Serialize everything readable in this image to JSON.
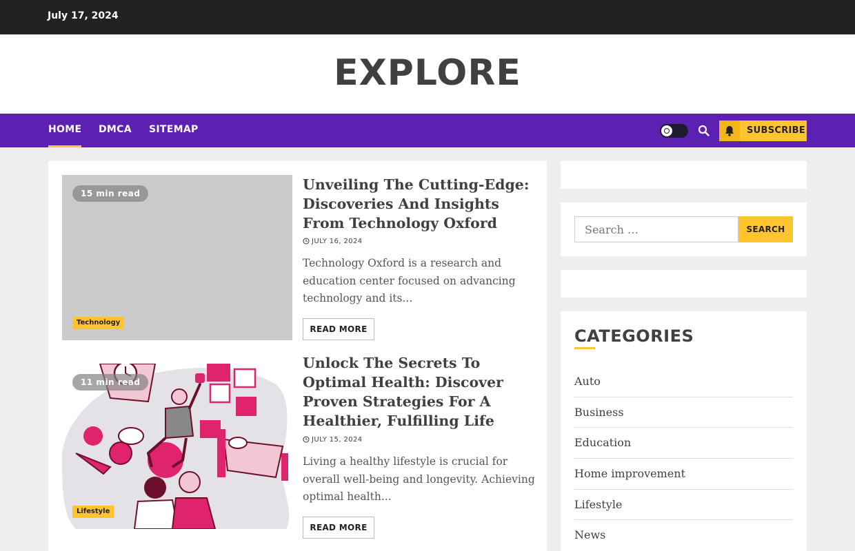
{
  "topbar": {
    "date": "July 17, 2024"
  },
  "site": {
    "title": "EXPLORE"
  },
  "nav": {
    "items": [
      {
        "label": "HOME",
        "active": true
      },
      {
        "label": "DMCA",
        "active": false
      },
      {
        "label": "SITEMAP",
        "active": false
      }
    ],
    "subscribe_label": "SUBSCRIBE",
    "icons": {
      "theme_toggle": "light-dark-toggle-icon",
      "search": "search-icon",
      "bell": "bell-icon"
    }
  },
  "posts": [
    {
      "read_time": "15 min read",
      "category": "Technology",
      "title": "Unveiling The Cutting-Edge: Discoveries And Insights From Technology Oxford",
      "date": "JULY 16, 2024",
      "excerpt": "Technology Oxford is a research and education center focused on advancing technology and its...",
      "read_more": "READ MORE"
    },
    {
      "read_time": "11 min read",
      "category": "Lifestyle",
      "title": "Unlock The Secrets To Optimal Health: Discover Proven Strategies For A Healthier, Fulfilling Life",
      "date": "JULY 15, 2024",
      "excerpt": "Living a healthy lifestyle is crucial for overall well-being and longevity. Achieving optimal health...",
      "read_more": "READ MORE"
    }
  ],
  "sidebar": {
    "search": {
      "placeholder": "Search …",
      "button": "SEARCH"
    },
    "categories": {
      "heading": "CATEGORIES",
      "items": [
        "Auto",
        "Business",
        "Education",
        "Home improvement",
        "Lifestyle",
        "News"
      ]
    }
  },
  "colors": {
    "nav_bg": "#5c21b2",
    "accent": "#ffc42e",
    "topbar_bg": "#222222"
  }
}
